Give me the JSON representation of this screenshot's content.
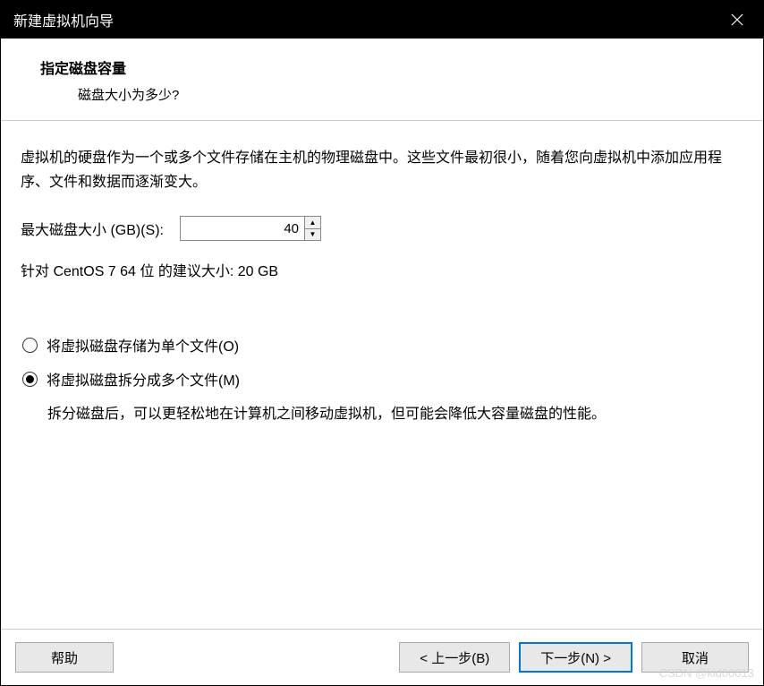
{
  "titlebar": {
    "title": "新建虚拟机向导"
  },
  "header": {
    "title": "指定磁盘容量",
    "subtitle": "磁盘大小为多少?"
  },
  "main": {
    "description": "虚拟机的硬盘作为一个或多个文件存储在主机的物理磁盘中。这些文件最初很小，随着您向虚拟机中添加应用程序、文件和数据而逐渐变大。",
    "size_label": "最大磁盘大小 (GB)(S):",
    "size_value": "40",
    "recommendation": "针对 CentOS 7 64 位 的建议大小: 20 GB"
  },
  "options": {
    "single_file": "将虚拟磁盘存储为单个文件(O)",
    "split_file": "将虚拟磁盘拆分成多个文件(M)",
    "split_hint": "拆分磁盘后，可以更轻松地在计算机之间移动虚拟机，但可能会降低大容量磁盘的性能。",
    "selected": "split_file"
  },
  "buttons": {
    "help": "帮助",
    "back": "< 上一步(B)",
    "next": "下一步(N) >",
    "cancel": "取消"
  },
  "watermark": "CSDN @kid00013"
}
